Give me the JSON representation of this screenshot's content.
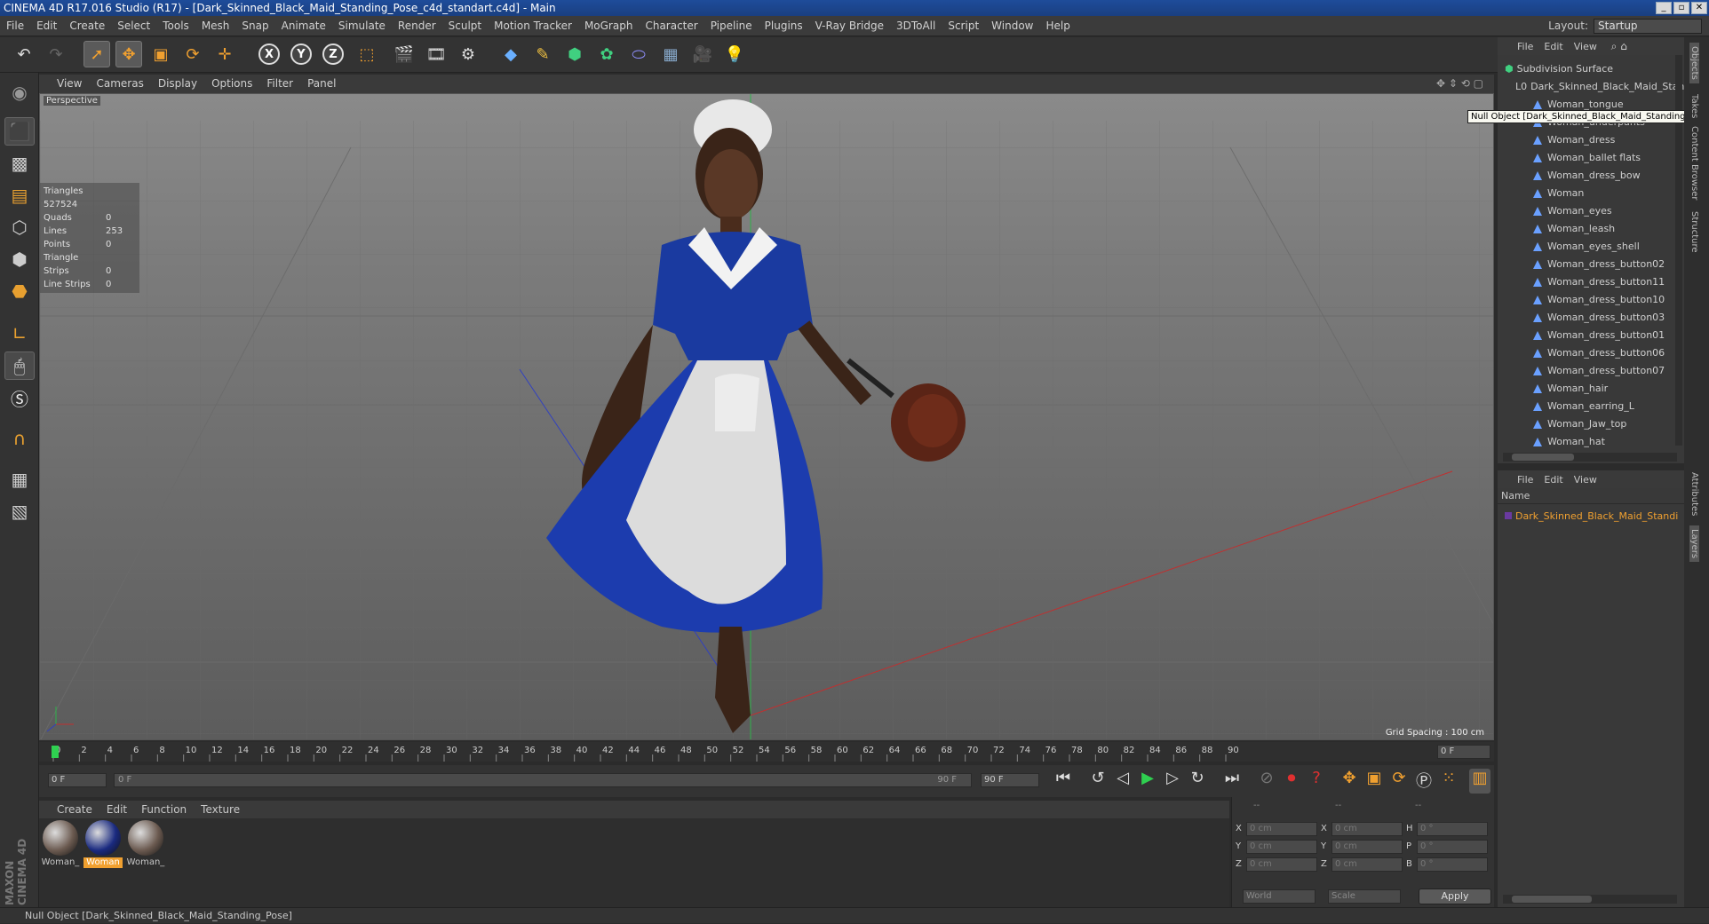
{
  "window": {
    "title": "CINEMA 4D R17.016 Studio (R17) - [Dark_Skinned_Black_Maid_Standing_Pose_c4d_standart.c4d] - Main"
  },
  "menu": [
    "File",
    "Edit",
    "Create",
    "Select",
    "Tools",
    "Mesh",
    "Snap",
    "Animate",
    "Simulate",
    "Render",
    "Sculpt",
    "Motion Tracker",
    "MoGraph",
    "Character",
    "Pipeline",
    "Plugins",
    "V-Ray Bridge",
    "3DToAll",
    "Script",
    "Window",
    "Help"
  ],
  "layout": {
    "label": "Layout:",
    "value": "Startup"
  },
  "viewport": {
    "menu": [
      "View",
      "Cameras",
      "Display",
      "Options",
      "Filter",
      "Panel"
    ],
    "camera_label": "Perspective",
    "stats": [
      {
        "label": "Triangles",
        "value": "527524"
      },
      {
        "label": "Quads",
        "value": "0"
      },
      {
        "label": "Lines",
        "value": "253"
      },
      {
        "label": "Points",
        "value": "0"
      },
      {
        "label": "Triangle Strips",
        "value": "0"
      },
      {
        "label": "Line Strips",
        "value": "0"
      }
    ],
    "grid_spacing": "Grid Spacing : 100 cm"
  },
  "timeline": {
    "ticks": [
      "0",
      "2",
      "4",
      "6",
      "8",
      "10",
      "12",
      "14",
      "16",
      "18",
      "20",
      "22",
      "24",
      "26",
      "28",
      "30",
      "32",
      "34",
      "36",
      "38",
      "40",
      "42",
      "44",
      "46",
      "48",
      "50",
      "52",
      "54",
      "56",
      "58",
      "60",
      "62",
      "64",
      "66",
      "68",
      "70",
      "72",
      "74",
      "76",
      "78",
      "80",
      "82",
      "84",
      "86",
      "88",
      "90"
    ],
    "current_frame": "0 F",
    "start_field": "0 F",
    "range_start": "0 F",
    "range_end": "90 F",
    "end_field": "90 F",
    "playhead": 0
  },
  "material": {
    "menu": [
      "Create",
      "Edit",
      "Function",
      "Texture"
    ],
    "items": [
      {
        "label": "Woman_",
        "selected": false,
        "color": "#6b5a50"
      },
      {
        "label": "Woman",
        "selected": true,
        "color": "#1a2a80"
      },
      {
        "label": "Woman_",
        "selected": false,
        "color": "#6b5a50"
      }
    ]
  },
  "coords": {
    "header": [
      "--",
      "--",
      "--"
    ],
    "rows": [
      {
        "a": "X",
        "v1": "0 cm",
        "b": "X",
        "v2": "0 cm",
        "c": "H",
        "v3": "0 °"
      },
      {
        "a": "Y",
        "v1": "0 cm",
        "b": "Y",
        "v2": "0 cm",
        "c": "P",
        "v3": "0 °"
      },
      {
        "a": "Z",
        "v1": "0 cm",
        "b": "Z",
        "v2": "0 cm",
        "c": "B",
        "v3": "0 °"
      }
    ],
    "mode1": "World",
    "mode2": "Scale",
    "apply": "Apply"
  },
  "objects": {
    "menu": [
      "File",
      "Edit",
      "View"
    ],
    "root": "Subdivision Surface",
    "null": "Dark_Skinned_Black_Maid_Standing_Pose",
    "tooltip": "Null Object [Dark_Skinned_Black_Maid_Standing_Pose]",
    "children": [
      "Woman_tongue",
      "Woman_underpants",
      "Woman_dress",
      "Woman_ballet flats",
      "Woman_dress_bow",
      "Woman",
      "Woman_eyes",
      "Woman_leash",
      "Woman_eyes_shell",
      "Woman_dress_button02",
      "Woman_dress_button11",
      "Woman_dress_button10",
      "Woman_dress_button03",
      "Woman_dress_button01",
      "Woman_dress_button06",
      "Woman_dress_button07",
      "Woman_hair",
      "Woman_earring_L",
      "Woman_Jaw_top",
      "Woman_hat"
    ]
  },
  "layers": {
    "menu": [
      "File",
      "Edit",
      "View"
    ],
    "column": "Name",
    "item": "Dark_Skinned_Black_Maid_Standing_Pose"
  },
  "right_tabs": [
    "Objects",
    "Takes",
    "Content Browser",
    "Structure",
    "Attributes",
    "Layers"
  ],
  "status": "Null Object [Dark_Skinned_Black_Maid_Standing_Pose]",
  "brand": "MAXON CINEMA 4D"
}
